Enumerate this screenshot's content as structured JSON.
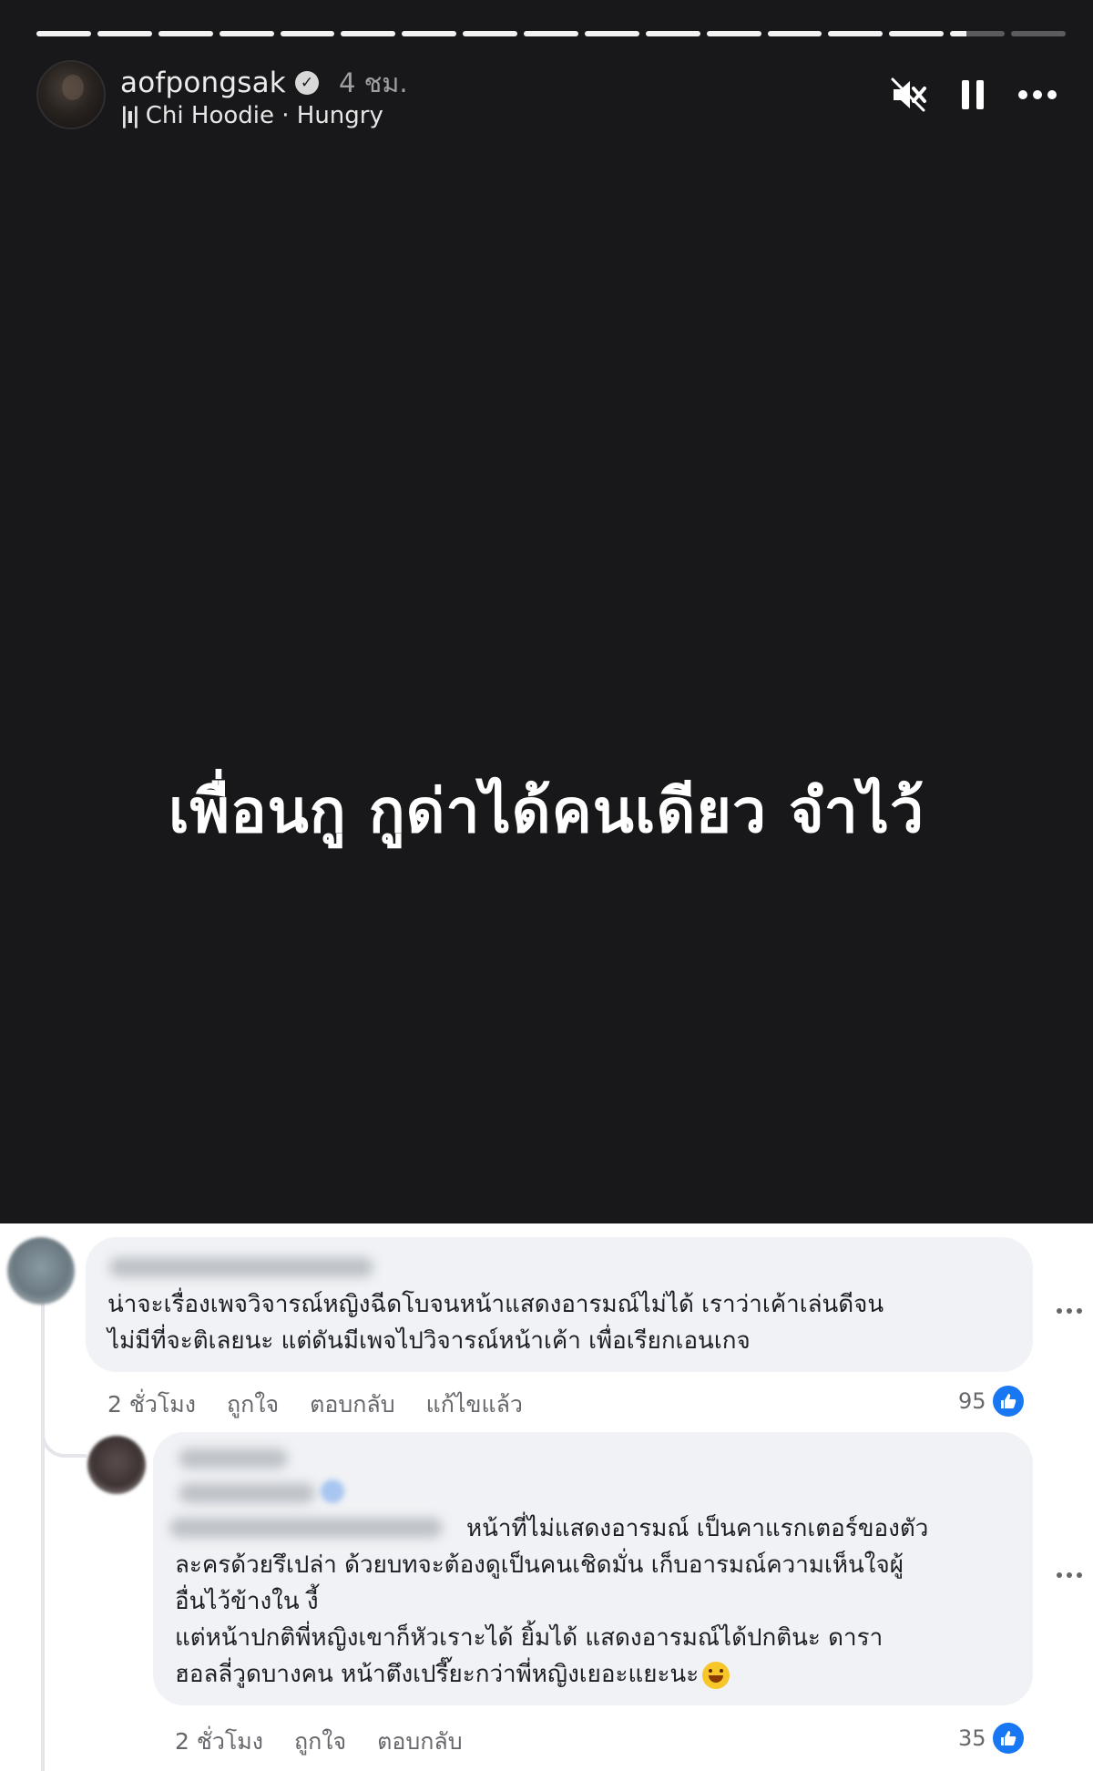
{
  "story": {
    "progress_segments": 17,
    "progress_filled_segments": 15,
    "progress_current_fraction": 0.3,
    "author": "aofpongsak",
    "verified": true,
    "time_ago": "4 ชม.",
    "music": "Chi Hoodie · Hungry",
    "text": "เพื่อนกู กูด่าได้คนเดียว จำไว้",
    "icons": {
      "mute": "muted-speaker-icon",
      "pause": "pause-icon",
      "more": "more-icon"
    }
  },
  "comments": [
    {
      "text_lines": [
        "น่าจะเรื่องเพจวิจารณ์หญิงฉีดโบจนหน้าแสดงอารมณ์ไม่ได้ เราว่าเค้าเล่นดีจน",
        "ไม่มีที่จะติเลยนะ แต่ดันมีเพจไปวิจารณ์หน้าเค้า เพื่อเรียกเอนเกจ"
      ],
      "time": "2 ชั่วโมง",
      "like_label": "ถูกใจ",
      "reply_label": "ตอบกลับ",
      "edited_label": "แก้ไขแล้ว",
      "like_count": "95"
    },
    {
      "text_lines": [
        "หน้าที่ไม่แสดงอารมณ์ เป็นคาแรกเตอร์ของตัว",
        "ละครด้วยรึเปล่า ด้วยบทจะต้องดูเป็นคนเชิดมั่น เก็บอารมณ์ความเห็นใจผู้",
        "อื่นไว้ข้างใน งี้",
        "แต่หน้าปกติพี่หญิงเขาก็หัวเราะได้ ยิ้มได้ แสดงอารมณ์ได้ปกตินะ ดารา",
        "ฮอลลี่วูดบางคน หน้าตึงเปรี๊ยะกว่าพี่หญิงเยอะแยะนะ"
      ],
      "emoji": "laughing-emoji",
      "time": "2 ชั่วโมง",
      "like_label": "ถูกใจ",
      "reply_label": "ตอบกลับ",
      "like_count": "35"
    }
  ]
}
